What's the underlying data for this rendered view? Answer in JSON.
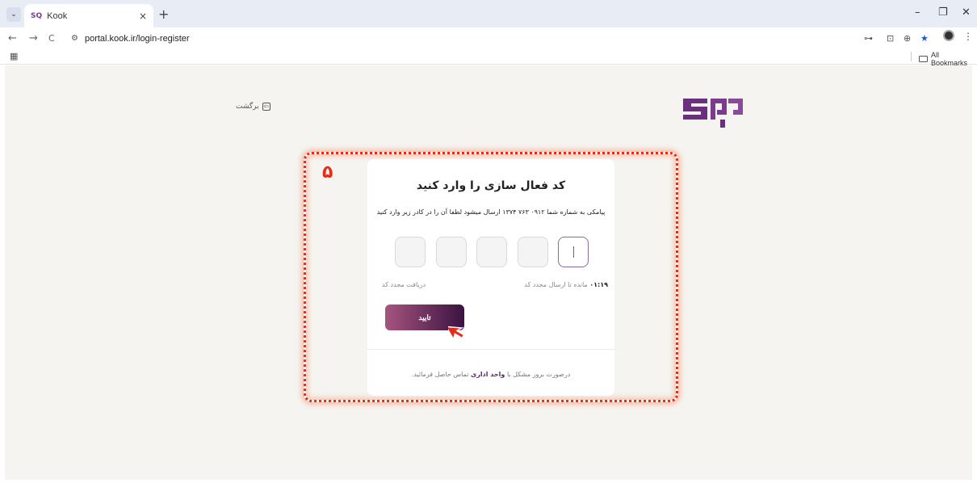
{
  "browser": {
    "tab": {
      "favicon": "SQ",
      "title": "Kook",
      "close": "×"
    },
    "new_tab": "+",
    "tab_list": "⌄",
    "window": {
      "minimize": "–",
      "restore": "❐",
      "close": "✕"
    },
    "nav": {
      "back": "←",
      "forward": "→",
      "reload": "C"
    },
    "site_info": "⚙",
    "url": "portal.kook.ir/login-register",
    "toolbar": {
      "password_key": "⊶",
      "install": "⊡",
      "zoom": "⊕",
      "bookmark_star": "★",
      "menu": "⋮"
    },
    "bookmarks": {
      "apps": "▦",
      "all_bookmarks": "All Bookmarks"
    }
  },
  "page": {
    "back_label": "برگشت",
    "back_icon": "⇦",
    "step_number": "۵",
    "card": {
      "title": "کد فعال سازی را وارد کنید",
      "subtitle": "پیامکی به شماره شما  ۰۹۱۲ ۷۶۳ ۱۳۷۴ ارسال میشود لطفا آن را در کادر زیر وارد کنید",
      "otp_boxes": 5,
      "timer": "۰۱:۱۹",
      "timer_suffix": " مانده تا ارسال مجدد کد",
      "resend": "دریافت مجدد کد",
      "confirm": "تایید",
      "footer_prefix": "درصورت بروز مشکل با ",
      "footer_link": "واحد اداری",
      "footer_suffix": " تماس حاصل فرمائید."
    }
  },
  "colors": {
    "brand_purple": "#5a2a6e",
    "button_gradient": [
      "#a6547f",
      "#3a1340"
    ],
    "highlight_red": "#e42c1a"
  }
}
